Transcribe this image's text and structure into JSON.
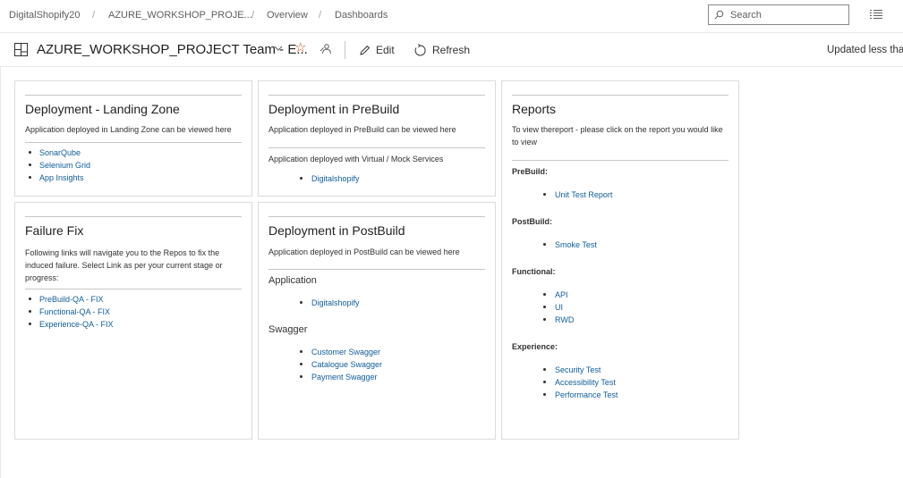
{
  "breadcrumb": {
    "org": "DigitalShopify20",
    "project": "AZURE_WORKSHOP_PROJE...",
    "overview": "Overview",
    "dashboards": "Dashboards",
    "separator": "/"
  },
  "search": {
    "placeholder": "Search"
  },
  "header": {
    "title": "AZURE_WORKSHOP_PROJECT Team - E...",
    "edit_label": "Edit",
    "refresh_label": "Refresh",
    "updated_text": "Updated less than"
  },
  "widgets": {
    "landing": {
      "title": "Deployment - Landing Zone",
      "desc": "Application deployed in Landing Zone can be viewed here",
      "links": [
        "SonarQube",
        "Selenium Grid",
        "App Insights"
      ]
    },
    "prebuild": {
      "title": "Deployment in PreBuild",
      "desc": "Application deployed in PreBuild can be viewed here",
      "sub": "Application deployed with Virtual / Mock Services",
      "links": [
        "Digitalshopify"
      ]
    },
    "reports": {
      "title": "Reports",
      "desc": "To view thereport - please click on the report you would like to view",
      "sections": [
        {
          "label": "PreBuild:",
          "links": [
            "Unit Test Report"
          ]
        },
        {
          "label": "PostBuild:",
          "links": [
            "Smoke Test"
          ]
        },
        {
          "label": "Functional:",
          "links": [
            "API",
            "UI",
            "RWD"
          ]
        },
        {
          "label": "Experience:",
          "links": [
            "Security Test",
            "Accessibility Test",
            "Performance Test"
          ]
        }
      ]
    },
    "failure": {
      "title": "Failure Fix",
      "desc": "Following links will navigate you to the Repos to fix the induced failure. Select Link as per your current stage or progress:",
      "links": [
        "PreBuild-QA - FIX",
        "Functional-QA - FIX",
        "Experience-QA - FIX"
      ]
    },
    "postbuild": {
      "title": "Deployment in PostBuild",
      "desc": "Application deployed in PostBuild can be viewed here",
      "app_heading": "Application",
      "app_links": [
        "Digitalshopify"
      ],
      "swagger_heading": "Swagger",
      "swagger_links": [
        "Customer Swagger",
        "Catalogue Swagger",
        "Payment Swagger"
      ]
    }
  },
  "colors": {
    "link": "#0f5c9a",
    "star": "#ca5010",
    "border": "#dcdcdc"
  }
}
